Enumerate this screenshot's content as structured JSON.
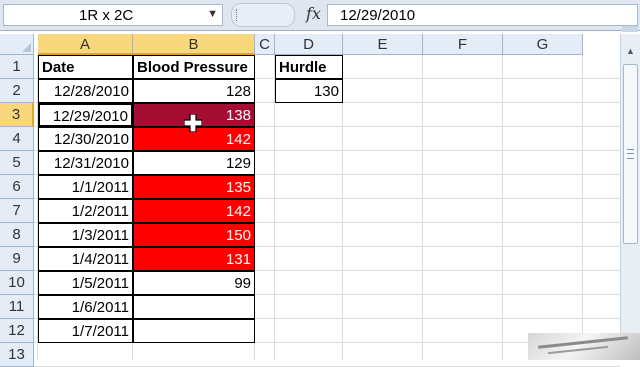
{
  "formula_bar": {
    "name_box": "1R x 2C",
    "fx_label": "fx",
    "formula": "12/29/2010"
  },
  "columns": [
    "A",
    "B",
    "C",
    "D",
    "E",
    "F",
    "G"
  ],
  "rows": [
    "1",
    "2",
    "3",
    "4",
    "5",
    "6",
    "7",
    "8",
    "9",
    "10",
    "11",
    "12",
    "13"
  ],
  "sheet": {
    "headers": {
      "date": "Date",
      "blood_pressure": "Blood Pressure",
      "hurdle": "Hurdle"
    },
    "hurdle_value": "130",
    "records": [
      {
        "date": "12/28/2010",
        "bp": "128",
        "fill": "none"
      },
      {
        "date": "12/29/2010",
        "bp": "138",
        "fill": "red-selected"
      },
      {
        "date": "12/30/2010",
        "bp": "142",
        "fill": "red"
      },
      {
        "date": "12/31/2010",
        "bp": "129",
        "fill": "none"
      },
      {
        "date": "1/1/2011",
        "bp": "135",
        "fill": "red"
      },
      {
        "date": "1/2/2011",
        "bp": "142",
        "fill": "red"
      },
      {
        "date": "1/3/2011",
        "bp": "150",
        "fill": "red"
      },
      {
        "date": "1/4/2011",
        "bp": "131",
        "fill": "red"
      },
      {
        "date": "1/5/2011",
        "bp": "99",
        "fill": "none"
      },
      {
        "date": "1/6/2011",
        "bp": "",
        "fill": "none"
      },
      {
        "date": "1/7/2011",
        "bp": "",
        "fill": "none"
      }
    ]
  },
  "colors": {
    "highlight": "#ff0000",
    "selected_highlight": "#a50e33",
    "header_selected": "#f9d87d"
  },
  "icons": {
    "cursor": "plus-cursor-icon",
    "fx": "fx-icon",
    "dropdown": "chevron-down-icon"
  }
}
